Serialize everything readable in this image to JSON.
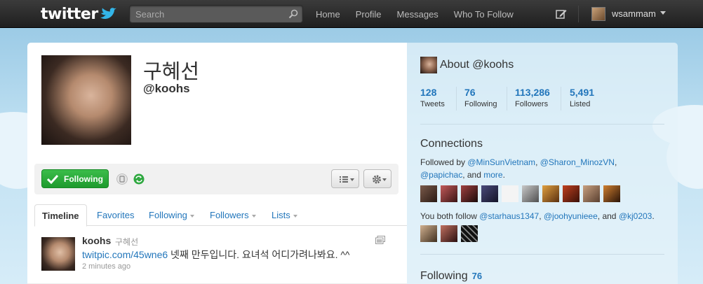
{
  "topbar": {
    "logo_text": "twitter",
    "search_placeholder": "Search",
    "nav": [
      "Home",
      "Profile",
      "Messages",
      "Who To Follow"
    ],
    "username": "wsammam"
  },
  "profile": {
    "name": "구혜선",
    "handle": "@koohs",
    "follow_label": "Following"
  },
  "tabs": [
    "Timeline",
    "Favorites",
    "Following",
    "Followers",
    "Lists"
  ],
  "tweet": {
    "author": "koohs",
    "name": "구혜선",
    "link": "twitpic.com/45wne6",
    "text": " 넷째 만두입니다. 요녀석 어디가려나봐요. ^^",
    "time": "2 minutes ago"
  },
  "sidebar": {
    "about_title": "About @koohs",
    "stats": [
      {
        "num": "128",
        "label": "Tweets"
      },
      {
        "num": "76",
        "label": "Following"
      },
      {
        "num": "113,286",
        "label": "Followers"
      },
      {
        "num": "5,491",
        "label": "Listed"
      }
    ],
    "connections_title": "Connections",
    "followed_by_prefix": "Followed by ",
    "followed_by": [
      "@MinSunVietnam",
      "@Sharon_MinozVN",
      "@papichac"
    ],
    "more_label": "more",
    "both_follow_prefix": "You both follow ",
    "both_follow": [
      "@starhaus1347",
      "@joohyunieee",
      "@kj0203"
    ],
    "following_title": "Following",
    "following_count": "76"
  },
  "colors": {
    "link": "#2276bb",
    "follow_green": "#2aa83a",
    "topbar": "#2b2b2b"
  }
}
